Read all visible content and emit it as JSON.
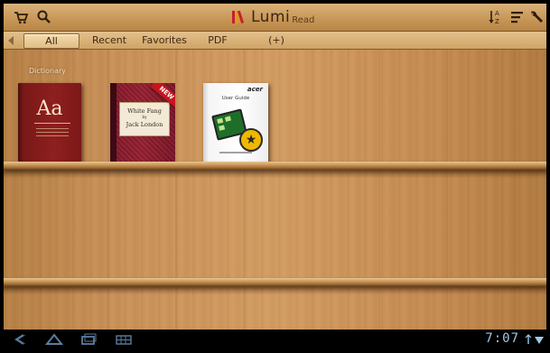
{
  "app": {
    "name": "LumiRead",
    "logo_main": "Lumi",
    "logo_sub": "Read"
  },
  "toolbar": {
    "left_icons": [
      "cart-icon",
      "search-icon"
    ],
    "right_icons": [
      "sort-az-icon",
      "list-view-icon",
      "settings-wrench-icon"
    ]
  },
  "tabs": [
    {
      "label": "All",
      "active": true
    },
    {
      "label": "Recent",
      "active": false
    },
    {
      "label": "Favorites",
      "active": false
    },
    {
      "label": "PDF",
      "active": false
    },
    {
      "label": "(+)",
      "active": false
    }
  ],
  "shelf": {
    "category_label": "Dictionary",
    "books": [
      {
        "cover_title": "Aa",
        "kind": "dictionary"
      },
      {
        "cover_title": "White Fang",
        "cover_by": "by",
        "cover_author": "Jack London",
        "badge": "NEW"
      },
      {
        "cover_brand": "acer",
        "cover_title": "User Guide",
        "favorite": true
      }
    ]
  },
  "statusbar": {
    "nav_icons": [
      "back-icon",
      "home-icon",
      "recent-apps-icon",
      "keyboard-grid-icon"
    ],
    "clock": "7:07",
    "status_icons": [
      "usb-icon",
      "wifi-icon"
    ],
    "accent": "#9ec9e8"
  }
}
